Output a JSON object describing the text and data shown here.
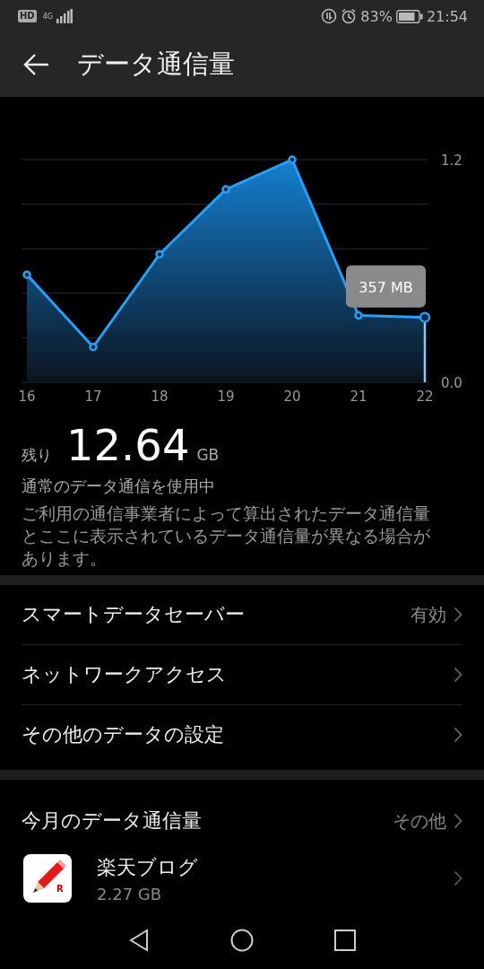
{
  "status_bar": {
    "hd": "HD",
    "network": "4G",
    "battery": "83%",
    "time": "21:54"
  },
  "app_bar": {
    "title": "データ通信量"
  },
  "chart_data": {
    "type": "area",
    "categories": [
      "16",
      "17",
      "18",
      "19",
      "20",
      "21",
      "22"
    ],
    "series": [
      {
        "color": "#2a9df4",
        "values": [
          0.58,
          0.19,
          0.69,
          1.04,
          1.2,
          0.36,
          0.35
        ]
      }
    ],
    "ylim": [
      0,
      1.2
    ],
    "yticks": [
      {
        "value": 0,
        "label": "0.0"
      },
      {
        "value": 1.2,
        "label": "1.2"
      }
    ],
    "annotations": [
      {
        "text": "357 MB"
      }
    ]
  },
  "remaining": {
    "label": "残り",
    "value": "12.64",
    "unit": "GB"
  },
  "mode_text": "通常のデータ通信を使用中",
  "notice": "ご利用の通信事業者によって算出されたデータ通信量とここに表示されているデータ通信量が異なる場合があります。",
  "settings": [
    {
      "label": "スマートデータセーバー",
      "value": "有効"
    },
    {
      "label": "ネットワークアクセス"
    },
    {
      "label": "その他のデータの設定"
    }
  ],
  "monthly": {
    "title": "今月のデータ通信量",
    "more": "その他",
    "apps": [
      {
        "name": "楽天ブログ",
        "usage": "2.27 GB",
        "icon_letter": "R"
      }
    ]
  }
}
